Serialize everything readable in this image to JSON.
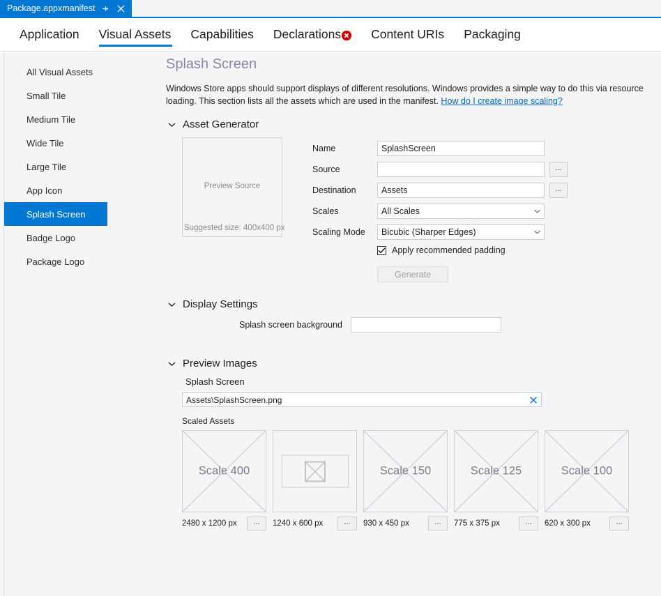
{
  "window": {
    "document_tab": {
      "title": "Package.appxmanifest",
      "pin_icon": "pin-icon",
      "close_icon": "close-icon"
    }
  },
  "category_tabs": [
    {
      "label": "Application",
      "active": false,
      "has_error": false
    },
    {
      "label": "Visual Assets",
      "active": true,
      "has_error": false
    },
    {
      "label": "Capabilities",
      "active": false,
      "has_error": false
    },
    {
      "label": "Declarations",
      "active": false,
      "has_error": true
    },
    {
      "label": "Content URIs",
      "active": false,
      "has_error": false
    },
    {
      "label": "Packaging",
      "active": false,
      "has_error": false
    }
  ],
  "sidebar": {
    "items": [
      {
        "label": "All Visual Assets",
        "selected": false
      },
      {
        "label": "Small Tile",
        "selected": false
      },
      {
        "label": "Medium Tile",
        "selected": false
      },
      {
        "label": "Wide Tile",
        "selected": false
      },
      {
        "label": "Large Tile",
        "selected": false
      },
      {
        "label": "App Icon",
        "selected": false
      },
      {
        "label": "Splash Screen",
        "selected": true
      },
      {
        "label": "Badge Logo",
        "selected": false
      },
      {
        "label": "Package Logo",
        "selected": false
      }
    ]
  },
  "main": {
    "page_title": "Splash Screen",
    "description_part1": "Windows Store apps should support displays of different resolutions. Windows provides a simple way to do this via resource loading. This section lists all the assets which are used in the manifest. ",
    "description_link": "How do I create image scaling?",
    "asset_generator": {
      "header": "Asset Generator",
      "preview_source_label": "Preview Source",
      "preview_source_size": "Suggested size: 400x400 px",
      "fields": [
        {
          "label": "Name",
          "value": "SplashScreen",
          "has_browse": false,
          "type": "text"
        },
        {
          "label": "Source",
          "value": "",
          "has_browse": true,
          "type": "text"
        },
        {
          "label": "Destination",
          "value": "Assets",
          "has_browse": true,
          "type": "text"
        },
        {
          "label": "Scales",
          "value": "All Scales",
          "has_browse": false,
          "type": "select"
        },
        {
          "label": "Scaling Mode",
          "value": "Bicubic (Sharper Edges)",
          "has_browse": false,
          "type": "select"
        }
      ],
      "browse_button_label": "...",
      "checkbox_label": "Apply recommended padding",
      "checkbox_checked": true,
      "generate_button_label": "Generate",
      "generate_button_enabled": false
    },
    "display_settings": {
      "header": "Display Settings",
      "background_label": "Splash screen background",
      "background_value": ""
    },
    "preview_images": {
      "header": "Preview Images",
      "subheader": "Splash Screen",
      "path_value": "Assets\\SplashScreen.png",
      "clear_icon": "close-icon",
      "scaled_assets_label": "Scaled Assets",
      "tiles": [
        {
          "caption": "Scale 400",
          "size": "2480 x 1200 px",
          "state": "placeholder",
          "button": "..."
        },
        {
          "caption": "",
          "size": "1240 x 600 px",
          "state": "broken-image",
          "button": "..."
        },
        {
          "caption": "Scale 150",
          "size": "930 x 450 px",
          "state": "placeholder",
          "button": "..."
        },
        {
          "caption": "Scale 125",
          "size": "775 x 375 px",
          "state": "placeholder",
          "button": "..."
        },
        {
          "caption": "Scale 100",
          "size": "620 x 300 px",
          "state": "placeholder",
          "button": "..."
        }
      ]
    }
  },
  "colors": {
    "accent": "#0078d4",
    "error": "#d40000",
    "page_title": "#8b85a8",
    "link": "#0066cc",
    "background": "#f5f5f5"
  }
}
